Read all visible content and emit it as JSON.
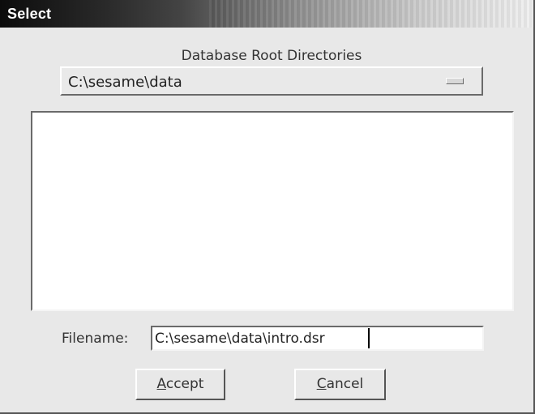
{
  "window": {
    "title": "Select"
  },
  "database": {
    "section_label": "Database Root Directories",
    "selected_directory": "C:\\sesame\\data"
  },
  "listbox": {
    "items": []
  },
  "filename": {
    "label": "Filename:",
    "value": "C:\\sesame\\data\\intro.dsr"
  },
  "buttons": {
    "accept": {
      "mnemonic": "A",
      "rest": "ccept"
    },
    "cancel": {
      "mnemonic": "C",
      "rest": "ancel"
    }
  }
}
